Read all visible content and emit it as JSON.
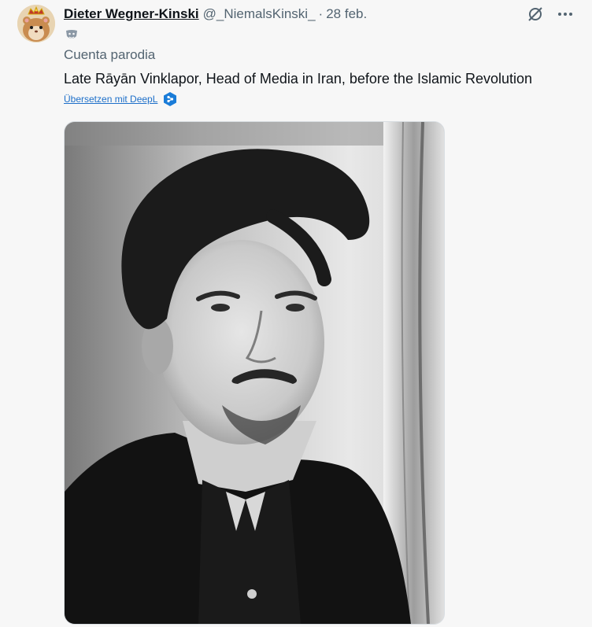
{
  "tweet": {
    "author_name": "Dieter Wegner-Kinski",
    "handle": "@_NiemalsKinski_",
    "separator": "·",
    "date": "28 feb.",
    "parody_label": "Cuenta parodia",
    "text": "Late Rāyān Vinklapor, Head of Media in Iran, before the Islamic Revolution",
    "translate_link": "Übersetzen mit DeepL"
  },
  "icons": {
    "grok": "grok-icon",
    "more": "more-icon",
    "badge": "theater-mask-icon",
    "deepl": "deepl-icon"
  },
  "colors": {
    "background": "#f7f7f7",
    "secondary_text": "#536471",
    "link": "#1d6fc9",
    "deepl_blue": "#1a7cd8"
  }
}
